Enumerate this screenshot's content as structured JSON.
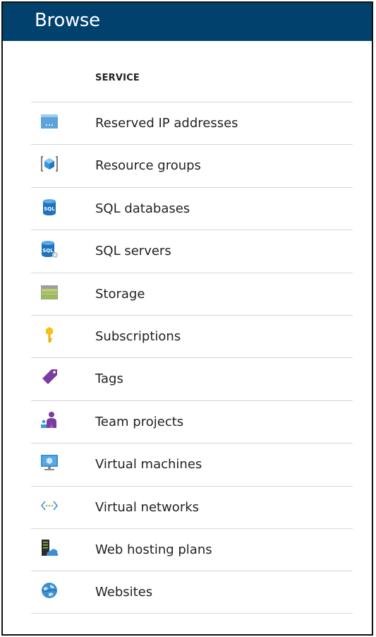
{
  "header": {
    "title": "Browse"
  },
  "list": {
    "column_header": "SERVICE",
    "items": [
      {
        "label": "Reserved IP addresses",
        "icon": "reserved-ip-icon"
      },
      {
        "label": "Resource groups",
        "icon": "resource-group-icon"
      },
      {
        "label": "SQL databases",
        "icon": "sql-database-icon"
      },
      {
        "label": "SQL servers",
        "icon": "sql-server-icon"
      },
      {
        "label": "Storage",
        "icon": "storage-icon"
      },
      {
        "label": "Subscriptions",
        "icon": "key-icon"
      },
      {
        "label": "Tags",
        "icon": "tag-icon"
      },
      {
        "label": "Team projects",
        "icon": "team-projects-icon"
      },
      {
        "label": "Virtual machines",
        "icon": "virtual-machine-icon"
      },
      {
        "label": "Virtual networks",
        "icon": "virtual-network-icon"
      },
      {
        "label": "Web hosting plans",
        "icon": "web-hosting-plan-icon"
      },
      {
        "label": "Websites",
        "icon": "website-icon"
      }
    ]
  },
  "colors": {
    "header_bg": "#00416e",
    "header_text": "#ffffff",
    "row_divider": "#d6d6d6"
  }
}
